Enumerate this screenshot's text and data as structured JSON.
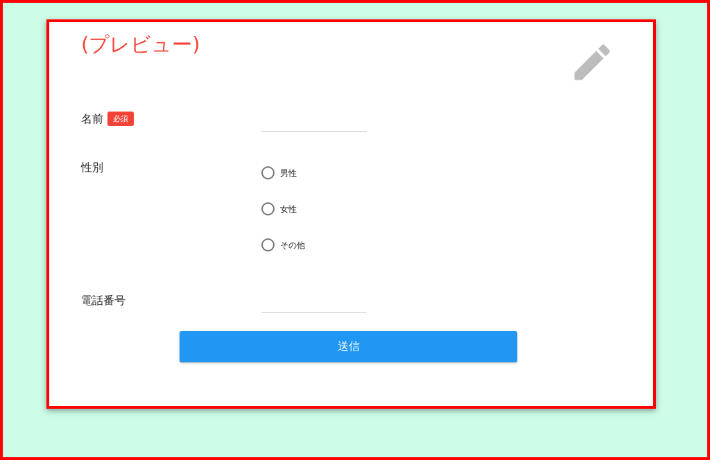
{
  "title": "(プレビュー)",
  "fields": [
    {
      "kind": "text",
      "label": "名前",
      "required_badge": "必須"
    },
    {
      "kind": "radio",
      "label": "性別",
      "options": [
        {
          "label": "男性",
          "selected": false
        },
        {
          "label": "女性",
          "selected": false
        },
        {
          "label": "その他",
          "selected": false
        }
      ]
    },
    {
      "kind": "text",
      "label": "電話番号"
    }
  ],
  "submit_button": "送信"
}
